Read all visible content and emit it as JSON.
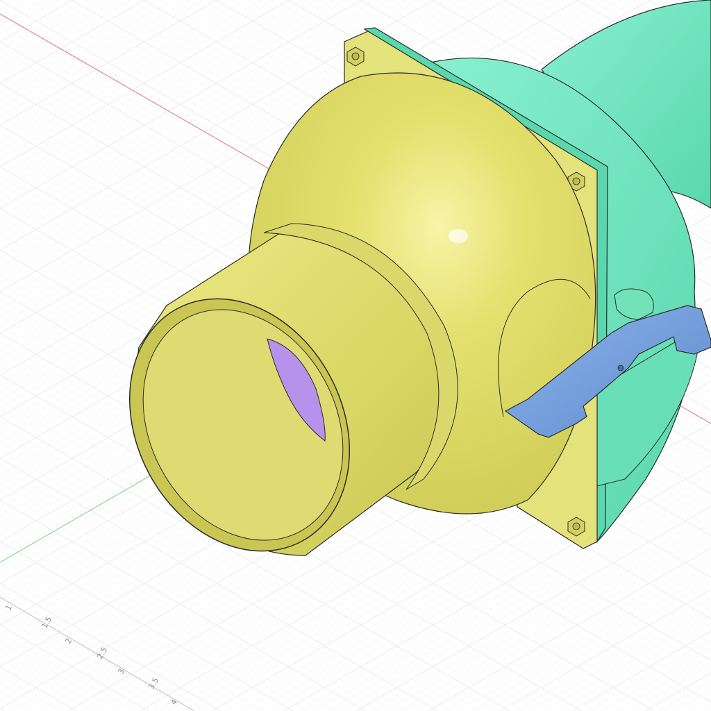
{
  "viewport": {
    "name": "3D modeling canvas",
    "ruler_labels": [
      "1",
      "1.5",
      "2",
      "2.5",
      "3",
      "3.5",
      "4"
    ]
  },
  "model": {
    "bodies": [
      {
        "name": "nozzle-body",
        "color": "#d9d866"
      },
      {
        "name": "housing-body",
        "color": "#6fe6be"
      },
      {
        "name": "clip-body",
        "color": "#6a97d6"
      },
      {
        "name": "inner-disc",
        "color": "#b692ea"
      }
    ]
  },
  "colors": {
    "grid_minor": "#eeeeee",
    "grid_major": "#d8d8d8",
    "axis_x": "#e06060",
    "axis_y": "#66cc66",
    "edge": "#2a2a2a"
  }
}
